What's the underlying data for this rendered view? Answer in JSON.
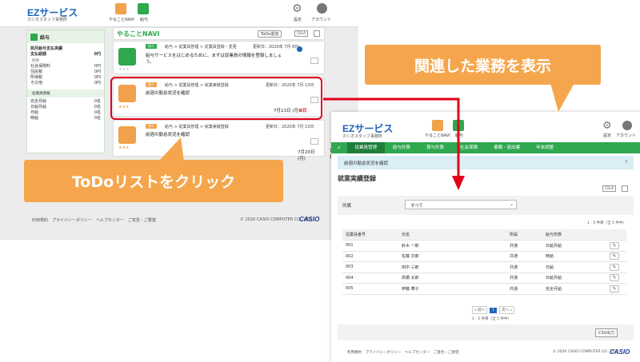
{
  "left": {
    "logo": "EZサービス",
    "logo_sub": "カシオスタッフ事務所",
    "header_icons": [
      {
        "label": "やることNAVI"
      },
      {
        "label": "給与"
      }
    ],
    "settings_label": "設定",
    "account_label": "アカウント",
    "panel": {
      "title": "給与",
      "section1_title": "前月給与支払実績",
      "paid_label": "支払総額",
      "paid_value": "0円",
      "sub_label": "控除",
      "rows1": [
        {
          "k": "社会保険料",
          "v": "0円"
        },
        {
          "k": "住民税",
          "v": "0円"
        },
        {
          "k": "所得税",
          "v": "0円"
        },
        {
          "k": "その他",
          "v": "0円"
        }
      ],
      "section2_title": "従業員情報",
      "rows2": [
        {
          "k": "完全月給",
          "v": "0名"
        },
        {
          "k": "日給月給",
          "v": "0名"
        },
        {
          "k": "日給",
          "v": "0名"
        },
        {
          "k": "時給",
          "v": "0名"
        }
      ]
    },
    "navi_title": "やることNAVI",
    "todo_add": "ToDo追加",
    "qa": "Q&A",
    "cards": [
      {
        "tag": "給与",
        "path": "給与 > 従業員管理 > 従業員登録・変更",
        "date": "更新日：2020年 7月 8日",
        "text": "給与サービスをはじめるために、まずは従業員の情報を登録しましょう。",
        "foot": ""
      },
      {
        "tag": "個人",
        "path": "給与 > 従業員管理 > 就業実績登録",
        "date": "更新日：2020年 7月 13日",
        "text": "前週の勤怠状況を確認",
        "foot": "7月13日 (月)",
        "count": "0日"
      },
      {
        "tag": "個人",
        "path": "給与 > 従業員管理 > 就業実績登録",
        "date": "更新日：2020年 7月 13日",
        "text": "前週の勤怠状況を確認",
        "foot": "7月20日 (月)",
        "count": "7日"
      }
    ],
    "footer_links": "利用規約　プライバシーポリシー　ヘルプセンター　ご意見・ご要望",
    "copyright": "© 2020 CASIO COMPUTER CO., LTD.",
    "casio": "CASIO"
  },
  "right": {
    "logo": "EZサービス",
    "logo_sub": "カシオスタッフ事務所",
    "header_icons": [
      {
        "label": "やることNAVI"
      },
      {
        "label": "給与"
      }
    ],
    "settings_label": "設定",
    "account_label": "アカウント",
    "nav": [
      "従業員管理",
      "給与計算",
      "賞与計算",
      "社会保険",
      "書類・届出書",
      "年末調整"
    ],
    "banner": "前週の勤怠状況を確認",
    "title": "就業実績登録",
    "qa": "Q&A",
    "filter_label": "所属",
    "filter_value": "すべて",
    "count": "1 - 5 件目（全 5 件中）",
    "columns": [
      "従業員番号",
      "氏名",
      "所属",
      "給与形態"
    ],
    "rows": [
      [
        "001",
        "鈴木 一郎",
        "共通",
        "日給月給"
      ],
      [
        "002",
        "佐藤 次郎",
        "共通",
        "時給"
      ],
      [
        "003",
        "田中 三郎",
        "共通",
        "日給"
      ],
      [
        "004",
        "高橋 太郎",
        "共通",
        "日給月給"
      ],
      [
        "005",
        "伊藤 華子",
        "共通",
        "完全月給"
      ]
    ],
    "pager_prev": "« 前へ",
    "pager_page": "1",
    "pager_next": "次へ »",
    "pager_count": "1 - 5 件目（全 5 件中）",
    "csv": "CSV出力",
    "footer_links": "利用規約　プライバシーポリシー　ヘルプセンター　ご意見・ご要望",
    "copyright": "© 2020 CASIO COMPUTER CO., LTD.",
    "casio": "CASIO"
  },
  "callouts": {
    "top": "関連した業務を表示",
    "bottom": "ToDoリストをクリック"
  },
  "colors": {
    "accent": "#f5a64c",
    "highlight": "#e3001b",
    "nav": "#2fa84f"
  }
}
